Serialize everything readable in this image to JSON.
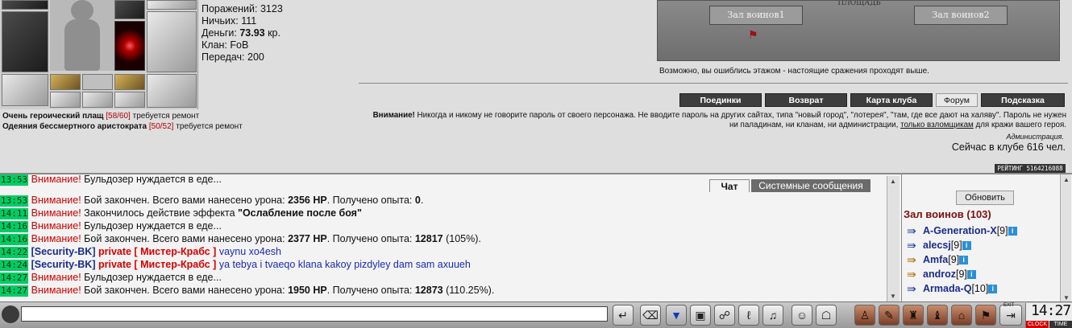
{
  "stats": {
    "defeats": "Поражений: 3123",
    "draws": "Ничьих: 111",
    "money_label": "Деньги: ",
    "money_value": "73.93",
    "money_unit": " кр.",
    "clan": "Клан: FoB",
    "transfers": "Передач: 200"
  },
  "repair_items": [
    {
      "name": "Очень героический плащ",
      "count": "[58/60]",
      "note": " требуется ремонт"
    },
    {
      "name": "Одеяния бессмертного аристократа",
      "count": "[50/52]",
      "note": " требуется ремонт"
    }
  ],
  "map": {
    "square_label": "ПЛОЩАДЬ",
    "hall1": "Зал воинов1",
    "hall2": "Зал воинов2",
    "note": "Возможно, вы ошиблись этажом - настоящие сражения проходят выше."
  },
  "nav": {
    "duels": "Поединки",
    "back": "Возврат",
    "club_map": "Карта клуба",
    "forum": "Форум",
    "hint": "Подсказка"
  },
  "warning": {
    "title": "Внимание!",
    "text1": " Никогда и никому не говорите пароль от своего персонажа. Не вводите пароль на других сайтах, типа \"новый город\", \"лотерея\", \"там, где все дают на халяву\". Пароль не нужен ни паладинам, ни кланам, ни администрации, ",
    "link": "только взломщикам",
    "text2": " для кражи вашего героя.",
    "admin": "Администрация.",
    "online": "Сейчас в клубе 616 чел.",
    "rating": "РЕЙТИНГ 5164216088"
  },
  "chat": {
    "tab_chat": "Чат",
    "tab_system": "Системные сообщения",
    "messages": [
      {
        "time": "13:53",
        "a": "Внимание!",
        "text": " Бульдозер нуждается в еде..."
      },
      {
        "time": "13:53",
        "a": "Внимание!",
        "text": " Бой закончен. Всего вами нанесено урона: ",
        "dmg": "2356 HP",
        "mid": ". Получено опыта: ",
        "exp": "0",
        "tail": "."
      },
      {
        "time": "14:11",
        "a": "Внимание!",
        "text": " Закончилось действие эффекта ",
        "effect": "\"Ослабление после боя\""
      },
      {
        "time": "14:16",
        "a": "Внимание!",
        "text": " Бульдозер нуждается в еде..."
      },
      {
        "time": "14:16",
        "a": "Внимание!",
        "text": " Бой закончен. Всего вами нанесено урона: ",
        "dmg": "2377 HP",
        "mid": ". Получено опыта: ",
        "exp": "12817",
        "tail": " (105%)."
      },
      {
        "time": "14:22",
        "sender": "[Security-BK]",
        "priv": "private [ Мистер-Крабс ]",
        "ptext": " vaynu xo4esh"
      },
      {
        "time": "14:24",
        "sender": "[Security-BK]",
        "priv": "private [ Мистер-Крабс ]",
        "ptext": " ya tebya i tvaeqo klana kakoy pizdyley dam sam axuueh"
      },
      {
        "time": "14:27",
        "a": "Внимание!",
        "text": " Бульдозер нуждается в еде..."
      },
      {
        "time": "14:27",
        "a": "Внимание!",
        "text": " Бой закончен. Всего вами нанесено урона: ",
        "dmg": "1950 HP",
        "mid": ". Получено опыта: ",
        "exp": "12873",
        "tail": " (110.25%)."
      }
    ]
  },
  "players": {
    "refresh": "Обновить",
    "hall_title": "Зал воинов (103)",
    "list": [
      {
        "name": "A-Generation-X",
        "level": "[9]",
        "color": "blue"
      },
      {
        "name": "alecsj",
        "level": "[9]",
        "color": "blue"
      },
      {
        "name": "Amfa",
        "level": "[9]",
        "color": "orange"
      },
      {
        "name": "androz",
        "level": "[9]",
        "color": "orange"
      },
      {
        "name": "Armada-Q",
        "level": "[10]",
        "color": "blue"
      }
    ]
  },
  "toolbar": {
    "input_value": "",
    "exit_label": "EXIT",
    "clock": "14:27",
    "clock_label": "CLOCK",
    "time_label": "TIME"
  }
}
